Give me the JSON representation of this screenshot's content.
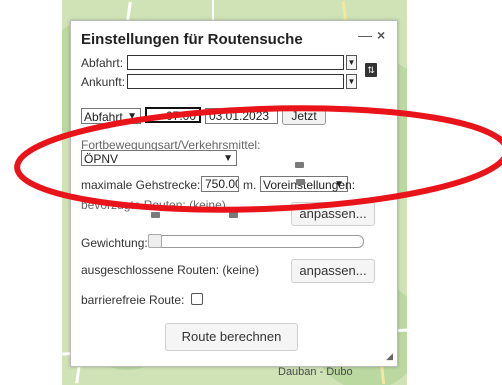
{
  "panel": {
    "title": "Einstellungen für Routensuche",
    "minimize_symbol": "—",
    "close_symbol": "×",
    "departure_label": "Abfahrt:",
    "departure_value": "",
    "arrival_label": "Ankunft:",
    "arrival_value": "",
    "swap_icon": "swap-icon",
    "time_mode": "Abfahrt",
    "time_value": "07:00",
    "date_value": "03.01.2023",
    "now_button": "Jetzt",
    "transport_label": "Fortbewegungsart/Verkehrsmittel:",
    "transport_value": "ÖPNV",
    "walk_label": "maximale Gehstrecke:",
    "walk_value": "750.00",
    "walk_unit": "m.",
    "presets_value": "Voreinstellungen:",
    "preferred_label": "bevorzugte Routen: (keine)",
    "adjust_button": "anpassen...",
    "weighting_label": "Gewichtung:",
    "weighting_level": 0,
    "excluded_label": "ausgeschlossene Routen: (keine)",
    "adjust_button2": "anpassen...",
    "barrierfree_label": "barrierefreie Route:",
    "barrierfree_checked": false,
    "calculate_button": "Route berechnen"
  },
  "map": {
    "place_label": "Dauban - Dubo"
  },
  "colors": {
    "annotation_ring": "#e8141a",
    "map_green": "#cfe3b7"
  }
}
